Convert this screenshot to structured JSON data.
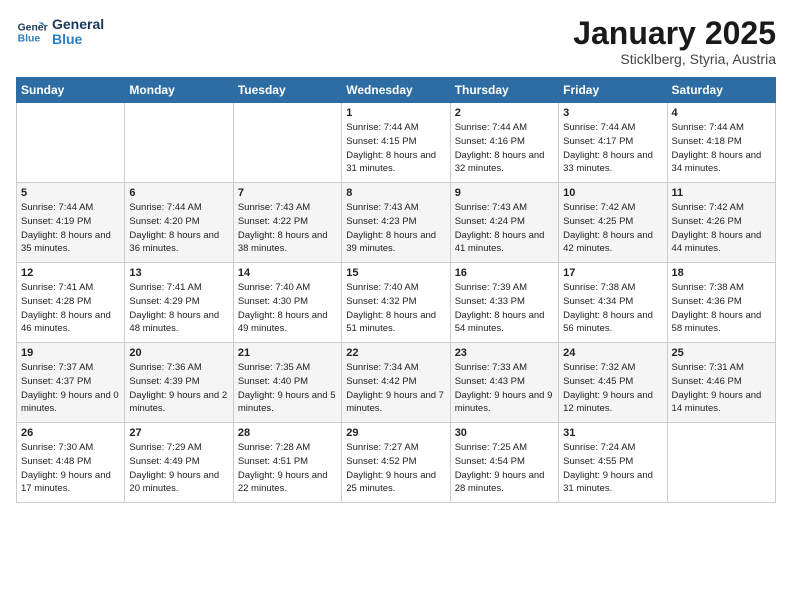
{
  "logo": {
    "line1": "General",
    "line2": "Blue"
  },
  "title": "January 2025",
  "subtitle": "Sticklberg, Styria, Austria",
  "days_of_week": [
    "Sunday",
    "Monday",
    "Tuesday",
    "Wednesday",
    "Thursday",
    "Friday",
    "Saturday"
  ],
  "weeks": [
    [
      {
        "day": "",
        "info": ""
      },
      {
        "day": "",
        "info": ""
      },
      {
        "day": "",
        "info": ""
      },
      {
        "day": "1",
        "info": "Sunrise: 7:44 AM\nSunset: 4:15 PM\nDaylight: 8 hours and 31 minutes."
      },
      {
        "day": "2",
        "info": "Sunrise: 7:44 AM\nSunset: 4:16 PM\nDaylight: 8 hours and 32 minutes."
      },
      {
        "day": "3",
        "info": "Sunrise: 7:44 AM\nSunset: 4:17 PM\nDaylight: 8 hours and 33 minutes."
      },
      {
        "day": "4",
        "info": "Sunrise: 7:44 AM\nSunset: 4:18 PM\nDaylight: 8 hours and 34 minutes."
      }
    ],
    [
      {
        "day": "5",
        "info": "Sunrise: 7:44 AM\nSunset: 4:19 PM\nDaylight: 8 hours and 35 minutes."
      },
      {
        "day": "6",
        "info": "Sunrise: 7:44 AM\nSunset: 4:20 PM\nDaylight: 8 hours and 36 minutes."
      },
      {
        "day": "7",
        "info": "Sunrise: 7:43 AM\nSunset: 4:22 PM\nDaylight: 8 hours and 38 minutes."
      },
      {
        "day": "8",
        "info": "Sunrise: 7:43 AM\nSunset: 4:23 PM\nDaylight: 8 hours and 39 minutes."
      },
      {
        "day": "9",
        "info": "Sunrise: 7:43 AM\nSunset: 4:24 PM\nDaylight: 8 hours and 41 minutes."
      },
      {
        "day": "10",
        "info": "Sunrise: 7:42 AM\nSunset: 4:25 PM\nDaylight: 8 hours and 42 minutes."
      },
      {
        "day": "11",
        "info": "Sunrise: 7:42 AM\nSunset: 4:26 PM\nDaylight: 8 hours and 44 minutes."
      }
    ],
    [
      {
        "day": "12",
        "info": "Sunrise: 7:41 AM\nSunset: 4:28 PM\nDaylight: 8 hours and 46 minutes."
      },
      {
        "day": "13",
        "info": "Sunrise: 7:41 AM\nSunset: 4:29 PM\nDaylight: 8 hours and 48 minutes."
      },
      {
        "day": "14",
        "info": "Sunrise: 7:40 AM\nSunset: 4:30 PM\nDaylight: 8 hours and 49 minutes."
      },
      {
        "day": "15",
        "info": "Sunrise: 7:40 AM\nSunset: 4:32 PM\nDaylight: 8 hours and 51 minutes."
      },
      {
        "day": "16",
        "info": "Sunrise: 7:39 AM\nSunset: 4:33 PM\nDaylight: 8 hours and 54 minutes."
      },
      {
        "day": "17",
        "info": "Sunrise: 7:38 AM\nSunset: 4:34 PM\nDaylight: 8 hours and 56 minutes."
      },
      {
        "day": "18",
        "info": "Sunrise: 7:38 AM\nSunset: 4:36 PM\nDaylight: 8 hours and 58 minutes."
      }
    ],
    [
      {
        "day": "19",
        "info": "Sunrise: 7:37 AM\nSunset: 4:37 PM\nDaylight: 9 hours and 0 minutes."
      },
      {
        "day": "20",
        "info": "Sunrise: 7:36 AM\nSunset: 4:39 PM\nDaylight: 9 hours and 2 minutes."
      },
      {
        "day": "21",
        "info": "Sunrise: 7:35 AM\nSunset: 4:40 PM\nDaylight: 9 hours and 5 minutes."
      },
      {
        "day": "22",
        "info": "Sunrise: 7:34 AM\nSunset: 4:42 PM\nDaylight: 9 hours and 7 minutes."
      },
      {
        "day": "23",
        "info": "Sunrise: 7:33 AM\nSunset: 4:43 PM\nDaylight: 9 hours and 9 minutes."
      },
      {
        "day": "24",
        "info": "Sunrise: 7:32 AM\nSunset: 4:45 PM\nDaylight: 9 hours and 12 minutes."
      },
      {
        "day": "25",
        "info": "Sunrise: 7:31 AM\nSunset: 4:46 PM\nDaylight: 9 hours and 14 minutes."
      }
    ],
    [
      {
        "day": "26",
        "info": "Sunrise: 7:30 AM\nSunset: 4:48 PM\nDaylight: 9 hours and 17 minutes."
      },
      {
        "day": "27",
        "info": "Sunrise: 7:29 AM\nSunset: 4:49 PM\nDaylight: 9 hours and 20 minutes."
      },
      {
        "day": "28",
        "info": "Sunrise: 7:28 AM\nSunset: 4:51 PM\nDaylight: 9 hours and 22 minutes."
      },
      {
        "day": "29",
        "info": "Sunrise: 7:27 AM\nSunset: 4:52 PM\nDaylight: 9 hours and 25 minutes."
      },
      {
        "day": "30",
        "info": "Sunrise: 7:25 AM\nSunset: 4:54 PM\nDaylight: 9 hours and 28 minutes."
      },
      {
        "day": "31",
        "info": "Sunrise: 7:24 AM\nSunset: 4:55 PM\nDaylight: 9 hours and 31 minutes."
      },
      {
        "day": "",
        "info": ""
      }
    ]
  ]
}
